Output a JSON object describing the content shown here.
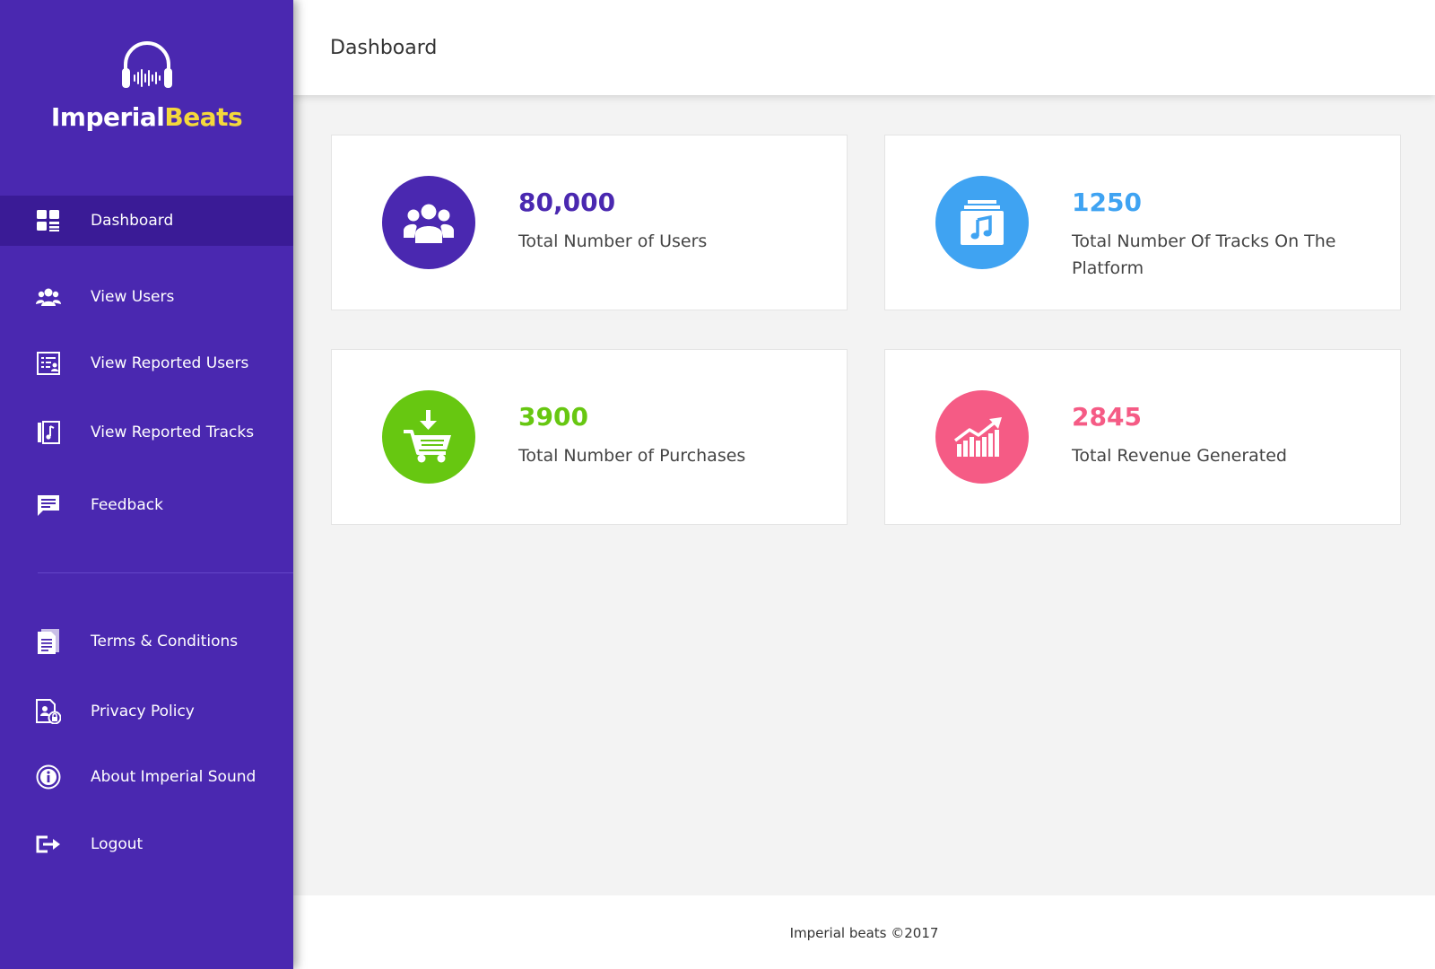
{
  "brand": {
    "name_part1": "Imperial",
    "name_part2": "Beats"
  },
  "colors": {
    "sidebar": "#4a28b0",
    "sidebar_active": "#3a1b96",
    "users": "#4a28b0",
    "tracks": "#3fa3f2",
    "purchases": "#67c711",
    "revenue": "#f55b85",
    "brand_yellow": "#f4d83c"
  },
  "sidebar": {
    "items": [
      {
        "label": "Dashboard",
        "icon": "dashboard-icon",
        "active": true
      },
      {
        "label": "View Users",
        "icon": "users-icon"
      },
      {
        "label": "View Reported Users",
        "icon": "reported-users-icon"
      },
      {
        "label": "View Reported Tracks",
        "icon": "reported-tracks-icon"
      },
      {
        "label": "Feedback",
        "icon": "feedback-icon"
      },
      {
        "label": "Terms & Conditions",
        "icon": "document-icon"
      },
      {
        "label": "Privacy Policy",
        "icon": "privacy-icon"
      },
      {
        "label": "About Imperial Sound",
        "icon": "info-icon"
      },
      {
        "label": "Logout",
        "icon": "logout-icon"
      }
    ]
  },
  "header": {
    "title": "Dashboard"
  },
  "stats": [
    {
      "value": "80,000",
      "label": "Total Number of Users",
      "icon": "users-icon"
    },
    {
      "value": "1250",
      "label": "Total Number Of Tracks On The Platform",
      "icon": "music-library-icon"
    },
    {
      "value": "3900",
      "label": "Total Number of Purchases",
      "icon": "cart-download-icon"
    },
    {
      "value": "2845",
      "label": "Total Revenue Generated",
      "icon": "growth-chart-icon"
    }
  ],
  "footer": {
    "text": "Imperial beats ©2017"
  }
}
